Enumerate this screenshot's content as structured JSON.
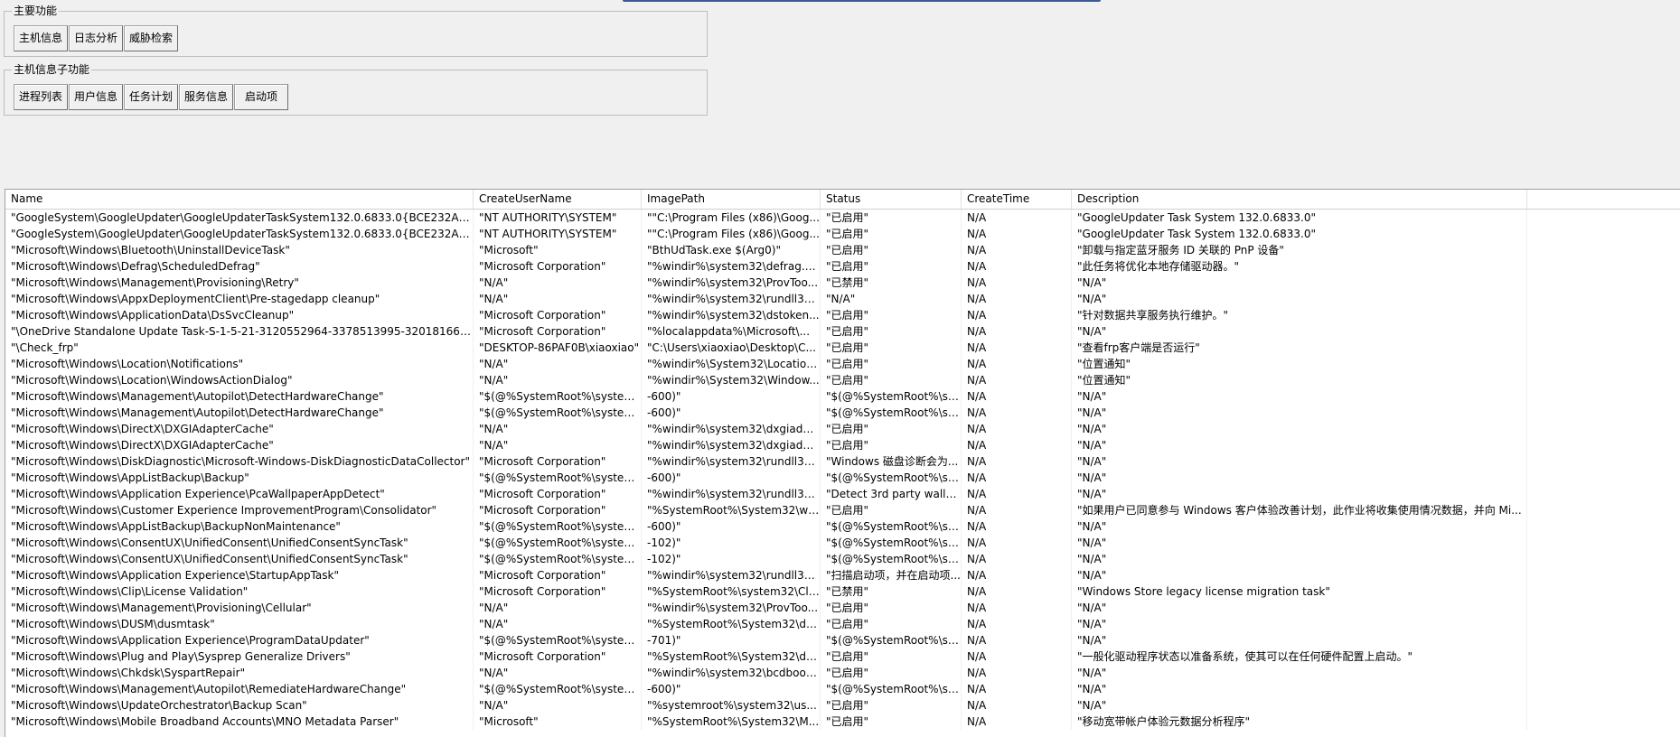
{
  "main_group": {
    "legend": "主要功能",
    "buttons": [
      "主机信息",
      "日志分析",
      "威胁检索"
    ]
  },
  "sub_group": {
    "legend": "主机信息子功能",
    "buttons": [
      "进程列表",
      "用户信息",
      "任务计划",
      "服务信息",
      "启动项"
    ]
  },
  "table": {
    "columns": [
      "Name",
      "CreateUserName",
      "ImagePath",
      "Status",
      "CreateTime",
      "Description"
    ],
    "rows": [
      [
        "\"GoogleSystem\\GoogleUpdater\\GoogleUpdaterTaskSystem132.0.6833.0{BCE232A7-05...",
        "\"NT AUTHORITY\\SYSTEM\"",
        "\"\"C:\\Program Files (x86)\\Goog...",
        "\"已启用\"",
        "N/A",
        "\"GoogleUpdater Task System 132.0.6833.0\""
      ],
      [
        "\"GoogleSystem\\GoogleUpdater\\GoogleUpdaterTaskSystem132.0.6833.0{BCE232A7-05...",
        "\"NT AUTHORITY\\SYSTEM\"",
        "\"\"C:\\Program Files (x86)\\Goog...",
        "\"已启用\"",
        "N/A",
        "\"GoogleUpdater Task System 132.0.6833.0\""
      ],
      [
        "\"Microsoft\\Windows\\Bluetooth\\UninstallDeviceTask\"",
        "\"Microsoft\"",
        "\"BthUdTask.exe $(Arg0)\"",
        "\"已启用\"",
        "N/A",
        "\"卸载与指定蓝牙服务 ID 关联的 PnP 设备\""
      ],
      [
        "\"Microsoft\\Windows\\Defrag\\ScheduledDefrag\"",
        "\"Microsoft Corporation\"",
        "\"%windir%\\system32\\defrag.e...",
        "\"已启用\"",
        "N/A",
        "\"此任务将优化本地存储驱动器。\""
      ],
      [
        "\"Microsoft\\Windows\\Management\\Provisioning\\Retry\"",
        "\"N/A\"",
        "\"%windir%\\system32\\ProvToo...",
        "\"已禁用\"",
        "N/A",
        "\"N/A\""
      ],
      [
        "\"Microsoft\\Windows\\AppxDeploymentClient\\Pre-stagedapp cleanup\"",
        "\"N/A\"",
        "\"%windir%\\system32\\rundll32....",
        "\"N/A\"",
        "N/A",
        "\"N/A\""
      ],
      [
        "\"Microsoft\\Windows\\ApplicationData\\DsSvcCleanup\"",
        "\"Microsoft Corporation\"",
        "\"%windir%\\system32\\dstoken...",
        "\"已启用\"",
        "N/A",
        "\"针对数据共享服务执行维护。\""
      ],
      [
        "\"\\OneDrive Standalone Update Task-S-1-5-21-3120552964-3378513995-3201816693-1...",
        "\"Microsoft Corporation\"",
        "\"%localappdata%\\Microsoft\\...",
        "\"已启用\"",
        "N/A",
        "\"N/A\""
      ],
      [
        "\"\\Check_frp\"",
        "\"DESKTOP-86PAF0B\\xiaoxiao\"",
        "\"C:\\Users\\xiaoxiao\\Desktop\\C...",
        "\"已启用\"",
        "N/A",
        "\"查看frp客户端是否运行\""
      ],
      [
        "\"Microsoft\\Windows\\Location\\Notifications\"",
        "\"N/A\"",
        "\"%windir%\\System32\\Location...",
        "\"已启用\"",
        "N/A",
        "\"位置通知\""
      ],
      [
        "\"Microsoft\\Windows\\Location\\WindowsActionDialog\"",
        "\"N/A\"",
        "\"%windir%\\System32\\Window...",
        "\"已启用\"",
        "N/A",
        "\"位置通知\""
      ],
      [
        "\"Microsoft\\Windows\\Management\\Autopilot\\DetectHardwareChange\"",
        "\"$(@%SystemRoot%\\system...",
        "-600)\"",
        "\"$(@%SystemRoot%\\sy...",
        "N/A",
        "\"N/A\""
      ],
      [
        "\"Microsoft\\Windows\\Management\\Autopilot\\DetectHardwareChange\"",
        "\"$(@%SystemRoot%\\system...",
        "-600)\"",
        "\"$(@%SystemRoot%\\sy...",
        "N/A",
        "\"N/A\""
      ],
      [
        "\"Microsoft\\Windows\\DirectX\\DXGIAdapterCache\"",
        "\"N/A\"",
        "\"%windir%\\system32\\dxgiada...",
        "\"已启用\"",
        "N/A",
        "\"N/A\""
      ],
      [
        "\"Microsoft\\Windows\\DirectX\\DXGIAdapterCache\"",
        "\"N/A\"",
        "\"%windir%\\system32\\dxgiada...",
        "\"已启用\"",
        "N/A",
        "\"N/A\""
      ],
      [
        "\"Microsoft\\Windows\\DiskDiagnostic\\Microsoft-Windows-DiskDiagnosticDataCollector\"",
        "\"Microsoft Corporation\"",
        "\"%windir%\\system32\\rundll32....",
        "\"Windows 磁盘诊断会为...",
        "N/A",
        "\"N/A\""
      ],
      [
        "\"Microsoft\\Windows\\AppListBackup\\Backup\"",
        "\"$(@%SystemRoot%\\system...",
        "-600)\"",
        "\"$(@%SystemRoot%\\sy...",
        "N/A",
        "\"N/A\""
      ],
      [
        "\"Microsoft\\Windows\\Application Experience\\PcaWallpaperAppDetect\"",
        "\"Microsoft Corporation\"",
        "\"%windir%\\system32\\rundll32....",
        "\"Detect 3rd party wallp...",
        "N/A",
        "\"N/A\""
      ],
      [
        "\"Microsoft\\Windows\\Customer Experience ImprovementProgram\\Consolidator\"",
        "\"Microsoft Corporation\"",
        "\"%SystemRoot%\\System32\\ws...",
        "\"已启用\"",
        "N/A",
        "\"如果用户已同意参与 Windows 客户体验改善计划，此作业将收集使用情况数据，并向 Mi..."
      ],
      [
        "\"Microsoft\\Windows\\AppListBackup\\BackupNonMaintenance\"",
        "\"$(@%SystemRoot%\\system...",
        "-600)\"",
        "\"$(@%SystemRoot%\\sy...",
        "N/A",
        "\"N/A\""
      ],
      [
        "\"Microsoft\\Windows\\ConsentUX\\UnifiedConsent\\UnifiedConsentSyncTask\"",
        "\"$(@%SystemRoot%\\system...",
        "-102)\"",
        "\"$(@%SystemRoot%\\sy...",
        "N/A",
        "\"N/A\""
      ],
      [
        "\"Microsoft\\Windows\\ConsentUX\\UnifiedConsent\\UnifiedConsentSyncTask\"",
        "\"$(@%SystemRoot%\\system...",
        "-102)\"",
        "\"$(@%SystemRoot%\\sy...",
        "N/A",
        "\"N/A\""
      ],
      [
        "\"Microsoft\\Windows\\Application Experience\\StartupAppTask\"",
        "\"Microsoft Corporation\"",
        "\"%windir%\\system32\\rundll32....",
        "\"扫描启动项，并在启动项...",
        "N/A",
        "\"N/A\""
      ],
      [
        "\"Microsoft\\Windows\\Clip\\License Validation\"",
        "\"Microsoft Corporation\"",
        "\"%SystemRoot%\\system32\\Cli...",
        "\"已禁用\"",
        "N/A",
        "\"Windows Store legacy license migration task\""
      ],
      [
        "\"Microsoft\\Windows\\Management\\Provisioning\\Cellular\"",
        "\"N/A\"",
        "\"%windir%\\system32\\ProvToo...",
        "\"已启用\"",
        "N/A",
        "\"N/A\""
      ],
      [
        "\"Microsoft\\Windows\\DUSM\\dusmtask\"",
        "\"N/A\"",
        "\"%SystemRoot%\\System32\\du...",
        "\"已启用\"",
        "N/A",
        "\"N/A\""
      ],
      [
        "\"Microsoft\\Windows\\Application Experience\\ProgramDataUpdater\"",
        "\"$(@%SystemRoot%\\system...",
        "-701)\"",
        "\"$(@%SystemRoot%\\sy...",
        "N/A",
        "\"N/A\""
      ],
      [
        "\"Microsoft\\Windows\\Plug and Play\\Sysprep Generalize Drivers\"",
        "\"Microsoft Corporation\"",
        "\"%SystemRoot%\\System32\\dr...",
        "\"已启用\"",
        "N/A",
        "\"一般化驱动程序状态以准备系统，使其可以在任何硬件配置上启动。\""
      ],
      [
        "\"Microsoft\\Windows\\Chkdsk\\SyspartRepair\"",
        "\"N/A\"",
        "\"%windir%\\system32\\bcdboot...",
        "\"已启用\"",
        "N/A",
        "\"N/A\""
      ],
      [
        "\"Microsoft\\Windows\\Management\\Autopilot\\RemediateHardwareChange\"",
        "\"$(@%SystemRoot%\\system...",
        "-600)\"",
        "\"$(@%SystemRoot%\\sy...",
        "N/A",
        "\"N/A\""
      ],
      [
        "\"Microsoft\\Windows\\UpdateOrchestrator\\Backup Scan\"",
        "\"N/A\"",
        "\"%systemroot%\\system32\\us...",
        "\"已启用\"",
        "N/A",
        "\"N/A\""
      ],
      [
        "\"Microsoft\\Windows\\Mobile Broadband Accounts\\MNO Metadata Parser\"",
        "\"Microsoft\"",
        "\"%SystemRoot%\\System32\\M...",
        "\"已启用\"",
        "N/A",
        "\"移动宽带帐户体验元数据分析程序\""
      ]
    ]
  }
}
